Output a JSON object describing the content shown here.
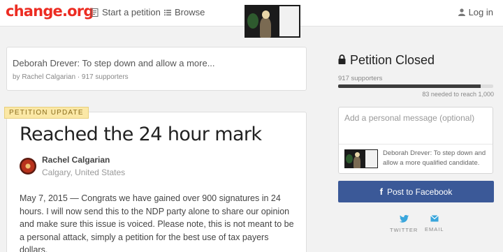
{
  "header": {
    "logo": "change.org",
    "nav": [
      {
        "label": "Start a petition",
        "icon": "document-icon"
      },
      {
        "label": "Browse",
        "icon": "list-icon"
      }
    ],
    "login": {
      "label": "Log in",
      "icon": "user-icon"
    }
  },
  "related_petition": {
    "title": "Deborah Drever: To step down and allow a more...",
    "meta": "by Rachel Calgarian · 917 supporters"
  },
  "update": {
    "badge": "PETITION UPDATE",
    "title": "Reached the 24 hour mark",
    "author_name": "Rachel Calgarian",
    "author_location": "Calgary, United States",
    "body": "May 7, 2015 — Congrats we have gained over 900 signatures in 24 hours. I will now send this to the NDP party alone to share our opinion and make sure this issue is voiced. Please note, this is not meant to be a personal attack, simply a petition for the best use of tax payers dollars."
  },
  "sidebar": {
    "status": "Petition Closed",
    "status_icon": "lock-icon",
    "supporters": "917 supporters",
    "progress_fraction": 0.917,
    "needed": "83 needed to reach 1,000",
    "message_placeholder": "Add a personal message (optional)",
    "share_preview_text": "Deborah Drever: To step down and allow a more qualified candidate.",
    "facebook_button": "Post to Facebook",
    "share_options": [
      {
        "label": "TWITTER",
        "icon": "twitter-icon"
      },
      {
        "label": "EMAIL",
        "icon": "email-icon"
      }
    ]
  },
  "colors": {
    "brand": "#ec2c22",
    "facebook": "#3b5998",
    "share_icon": "#3aa6dc"
  }
}
